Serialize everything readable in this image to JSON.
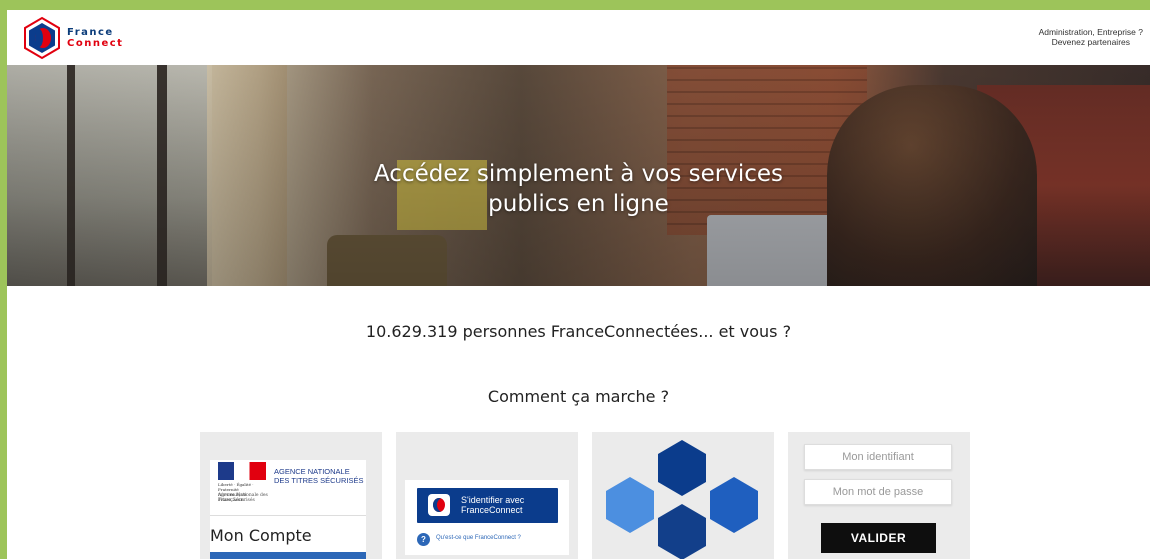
{
  "header": {
    "logo": {
      "line1": "France",
      "line2": "Connect"
    },
    "partner_line1": "Administration, Entreprise ?",
    "partner_line2": "Devenez partenaires"
  },
  "hero": {
    "title_line1": "Accédez simplement à vos services",
    "title_line2": "publics en ligne"
  },
  "counter_text": "10.629.319 personnes FranceConnectées... et vous ?",
  "how_title": "Comment ça marche ?",
  "cards": {
    "ants": {
      "rf_text": "Liberté · Égalité · Fraternité RÉPUBLIQUE FRANÇAISE",
      "agency_small": "Agence Nationale des Titres Sécurisés",
      "agency_name": "AGENCE NATIONALE DES TITRES SÉCURISÉS",
      "mon_compte": "Mon Compte"
    },
    "fc_button": {
      "label_line1": "S'identifier avec",
      "label_line2": "FranceConnect",
      "question": "Qu'est-ce que FranceConnect ?"
    },
    "login": {
      "identifier_placeholder": "Mon identifiant",
      "password_placeholder": "Mon mot de passe",
      "submit_label": "VALIDER"
    }
  },
  "colors": {
    "border_green": "#9dc45a",
    "brand_blue": "#0b3c8c",
    "brand_red": "#e1000f",
    "hex_colors": [
      "#0b3c8c",
      "#4c8fe0",
      "#1f5fbf",
      "#123f8a"
    ]
  }
}
